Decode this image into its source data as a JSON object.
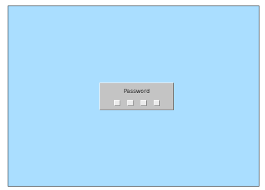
{
  "password_prompt": {
    "title": "Password",
    "digit_count": 4,
    "digits": [
      "",
      "",
      "",
      ""
    ]
  },
  "colors": {
    "screen_background": "#aadeff",
    "dialog_background": "#c4c4c4",
    "input_box_background": "#ebebeb"
  }
}
